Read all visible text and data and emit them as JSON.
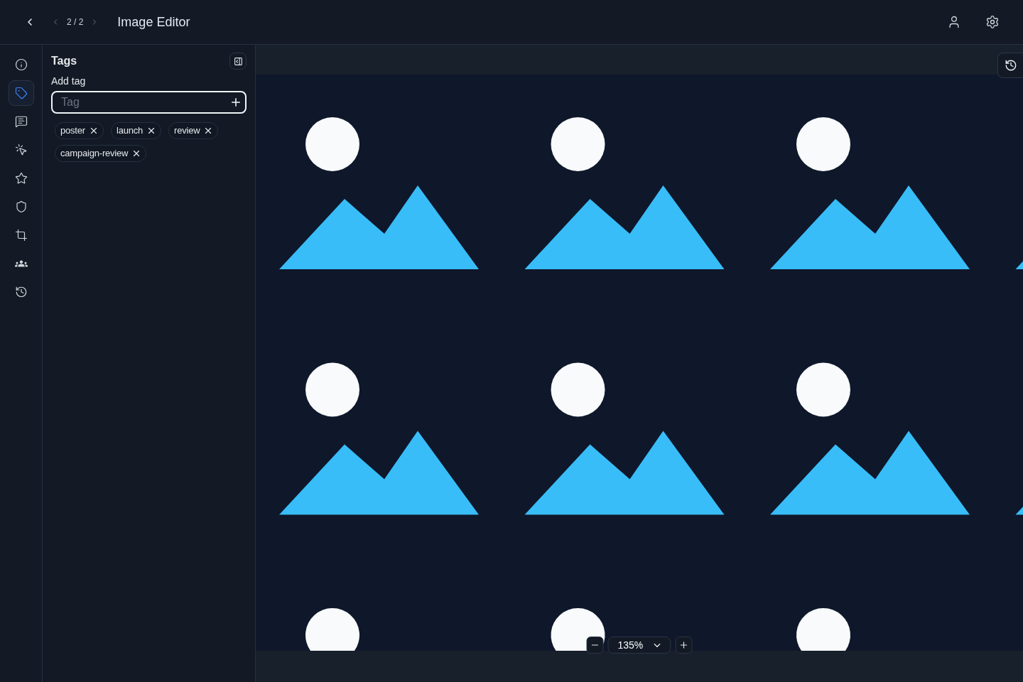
{
  "header": {
    "pager": "2 / 2",
    "title": "Image Editor"
  },
  "rail": [
    {
      "kind": "info",
      "selected": false
    },
    {
      "kind": "tags",
      "selected": true
    },
    {
      "kind": "comments",
      "selected": false
    },
    {
      "kind": "interactions",
      "selected": false
    },
    {
      "kind": "favorites",
      "selected": false
    },
    {
      "kind": "protection",
      "selected": false
    },
    {
      "kind": "crop",
      "selected": false
    },
    {
      "kind": "people",
      "selected": false
    },
    {
      "kind": "history",
      "selected": false
    }
  ],
  "panel": {
    "title": "Tags",
    "field_label": "Add tag",
    "input": {
      "placeholder": "Tag"
    },
    "tags": [
      "poster",
      "launch",
      "review",
      "campaign-review"
    ]
  },
  "zoom": {
    "value": "135%"
  }
}
